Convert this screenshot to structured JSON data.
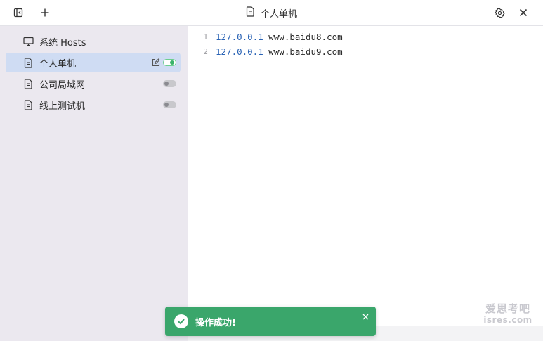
{
  "window": {
    "title": "个人单机"
  },
  "toolbar": {
    "toggle_sidebar_icon": "sidebar-toggle-icon",
    "add_icon": "plus-icon",
    "settings_icon": "gear-icon",
    "close_icon": "close-icon"
  },
  "sidebar": {
    "items": [
      {
        "label": "系统 Hosts",
        "icon": "monitor-icon",
        "active": false,
        "has_toggle": false
      },
      {
        "label": "个人单机",
        "icon": "file-icon",
        "active": true,
        "has_toggle": true,
        "enabled": true
      },
      {
        "label": "公司局域网",
        "icon": "file-icon",
        "active": false,
        "has_toggle": true,
        "enabled": false
      },
      {
        "label": "线上测试机",
        "icon": "file-icon",
        "active": false,
        "has_toggle": true,
        "enabled": false
      }
    ]
  },
  "editor": {
    "lines": [
      {
        "num": "1",
        "ip": "127.0.0.1",
        "host": " www.baidu8.com"
      },
      {
        "num": "2",
        "ip": "127.0.0.1",
        "host": " www.baidu9.com"
      }
    ]
  },
  "toast": {
    "message": "操作成功!"
  },
  "watermark": {
    "line1": "爱思考吧",
    "line2": "isres.com"
  },
  "colors": {
    "sidebar_bg": "#ebe8ef",
    "active_item": "#cfdcf3",
    "toast_bg": "#3aa66b",
    "ip_text": "#2a63b5",
    "toggle_on": "#3bb36b"
  }
}
